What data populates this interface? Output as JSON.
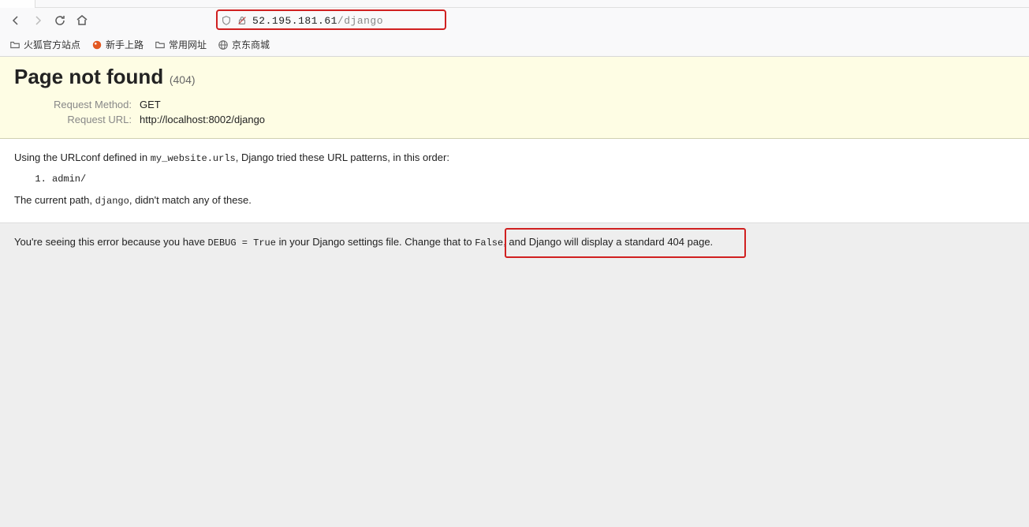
{
  "address": {
    "host": "52.195.181.61",
    "path": "/django"
  },
  "bookmarks": [
    {
      "label": "火狐官方站点",
      "icon": "folder"
    },
    {
      "label": "新手上路",
      "icon": "orange-circle"
    },
    {
      "label": "常用网址",
      "icon": "folder"
    },
    {
      "label": "京东商城",
      "icon": "globe"
    }
  ],
  "summary": {
    "title": "Page not found",
    "status_code": "(404)",
    "rows": [
      {
        "label": "Request Method:",
        "value": "GET"
      },
      {
        "label": "Request URL:",
        "value": "http://localhost:8002/django"
      }
    ]
  },
  "info": {
    "intro_pre": "Using the URLconf defined in ",
    "intro_code": "my_website.urls",
    "intro_post": ", Django tried these URL patterns, in this order:",
    "patterns": [
      "admin/"
    ],
    "outro_pre": "The current path, ",
    "outro_code": "django",
    "outro_post": ", didn't match any of these."
  },
  "explanation": {
    "text_a": "You're seeing this error because you have ",
    "code_a": "DEBUG = True",
    "text_b": " in your Django settings file. Change that to ",
    "code_b": "False",
    "text_c": ", and Django will display a standard 404 page."
  }
}
